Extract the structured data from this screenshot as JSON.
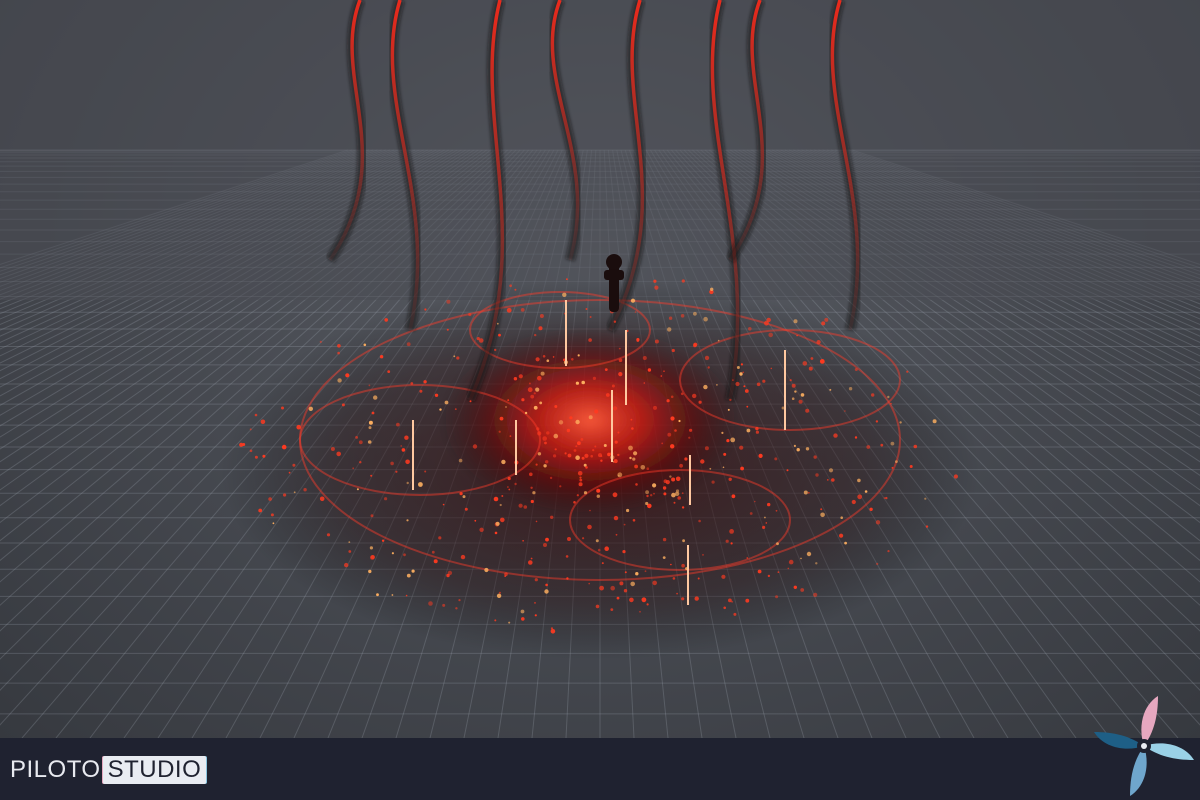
{
  "brand": {
    "piloto": "PILOTO",
    "studio": "STUDIO"
  },
  "colors": {
    "background": "#484b52",
    "grid_line": "#9aa0ab",
    "effect_red": "#ff2a1a",
    "effect_hot": "#ffb060",
    "footer": "#1f2230",
    "logo_blue": "#1e5f86",
    "logo_pink": "#e6a7bf",
    "logo_cyan": "#9ad1e6"
  },
  "icons": {
    "logo": "propeller-logo-icon"
  }
}
